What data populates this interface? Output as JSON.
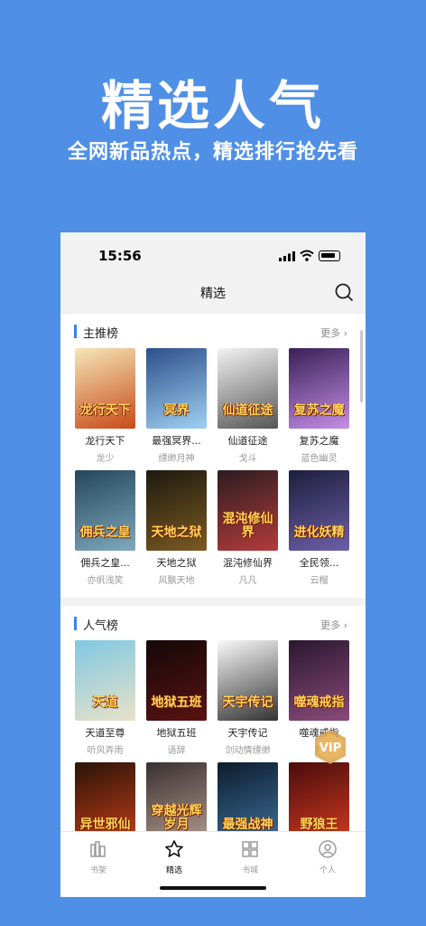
{
  "promo": {
    "headline": "精选人气",
    "subline": "全网新品热点，精选排行抢先看"
  },
  "status_bar": {
    "time": "15:56"
  },
  "nav": {
    "title": "精选"
  },
  "sections": [
    {
      "title": "主推榜",
      "more": "更多",
      "books": [
        {
          "title": "龙行天下",
          "author": "龙少",
          "cover_text": "龙行天下",
          "colors": [
            "#f5e6b8",
            "#c84a18"
          ]
        },
        {
          "title": "最强冥界...",
          "author": "缥缈月神",
          "cover_text": "冥界",
          "colors": [
            "#2c4f8a",
            "#9fd0f2"
          ]
        },
        {
          "title": "仙道征途",
          "author": "戈斗",
          "cover_text": "仙道征途",
          "colors": [
            "#f3f3f3",
            "#555555"
          ]
        },
        {
          "title": "复苏之魔",
          "author": "蓝色幽灵",
          "cover_text": "复苏之魔",
          "colors": [
            "#3a1f58",
            "#c48ee6"
          ]
        },
        {
          "title": "佣兵之皇...",
          "author": "亦帆浅笑",
          "cover_text": "佣兵之皇",
          "colors": [
            "#24465c",
            "#7fa9bd"
          ]
        },
        {
          "title": "天地之狱",
          "author": "风飘天地",
          "cover_text": "天地之狱",
          "colors": [
            "#1e1a10",
            "#7a5a22"
          ]
        },
        {
          "title": "混沌修仙界",
          "author": "凡凡",
          "cover_text": "混沌修仙界",
          "colors": [
            "#2c1d20",
            "#b43b3b"
          ]
        },
        {
          "title": "全民领...",
          "author": "云榴",
          "cover_text": "进化妖精",
          "colors": [
            "#1d1f3c",
            "#6d5fa8"
          ]
        }
      ]
    },
    {
      "title": "人气榜",
      "more": "更多",
      "books": [
        {
          "title": "天道至尊",
          "author": "听风弄雨",
          "cover_text": "天道",
          "colors": [
            "#7fc8e3",
            "#e8e2c8"
          ]
        },
        {
          "title": "地狱五班",
          "author": "语辞",
          "cover_text": "地狱五班",
          "colors": [
            "#140808",
            "#5a1212"
          ]
        },
        {
          "title": "天宇传记",
          "author": "剑动情缥缈",
          "cover_text": "天宇传记",
          "colors": [
            "#fafafa",
            "#333333"
          ]
        },
        {
          "title": "噬魂戒指",
          "author": "紫",
          "cover_text": "噬魂戒指",
          "colors": [
            "#2a1830",
            "#8a4a7a"
          ]
        },
        {
          "title": "",
          "author": "",
          "cover_text": "异世邪仙",
          "colors": [
            "#2a1408",
            "#c23c18"
          ]
        },
        {
          "title": "",
          "author": "",
          "cover_text": "穿越光辉岁月",
          "colors": [
            "#3a3032",
            "#b09a8c"
          ]
        },
        {
          "title": "",
          "author": "",
          "cover_text": "最强战神",
          "colors": [
            "#0c1c2c",
            "#3f6f9c"
          ]
        },
        {
          "title": "",
          "author": "",
          "cover_text": "野狼王",
          "colors": [
            "#4a0c0c",
            "#d23a20"
          ]
        }
      ]
    }
  ],
  "vip_badge": "VIP",
  "tabs": [
    {
      "label": "书架",
      "icon": "bookshelf-icon",
      "active": false
    },
    {
      "label": "精选",
      "icon": "star-icon",
      "active": true
    },
    {
      "label": "书城",
      "icon": "grid-icon",
      "active": false
    },
    {
      "label": "个人",
      "icon": "person-icon",
      "active": false
    }
  ]
}
